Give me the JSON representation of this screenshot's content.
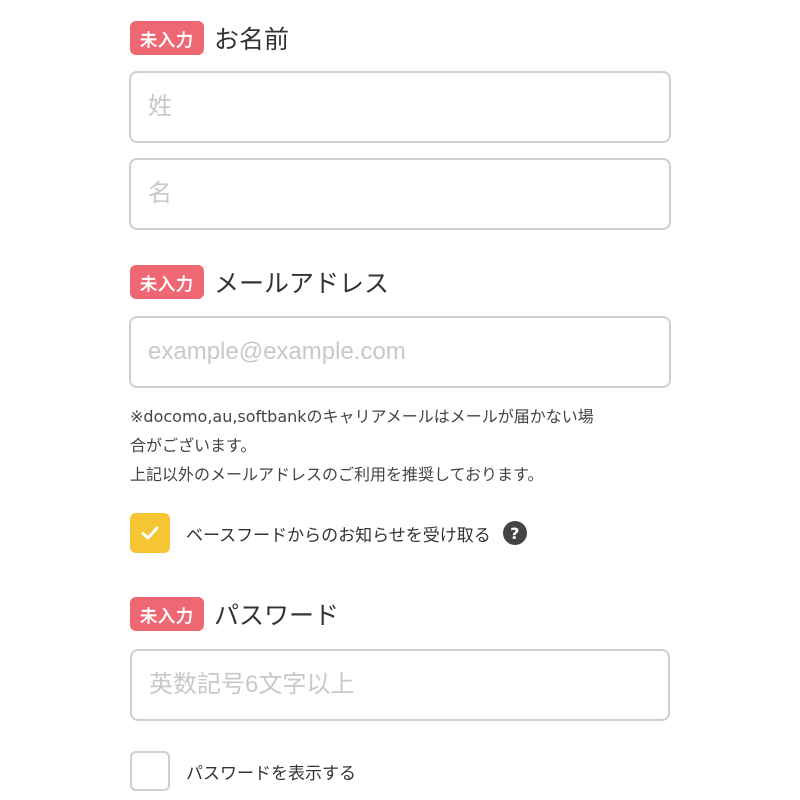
{
  "colors": {
    "badge_required": "#f06774",
    "checkbox_checked": "#f5c534",
    "help_icon": "#444444"
  },
  "name_section": {
    "badge": "未入力",
    "label": "お名前",
    "last_name_placeholder": "姓",
    "first_name_placeholder": "名"
  },
  "email_section": {
    "badge": "未入力",
    "label": "メールアドレス",
    "placeholder": "example@example.com",
    "note_lines": [
      "※docomo,au,softbankのキャリアメールはメールが届かない場",
      "合がございます。",
      "上記以外のメールアドレスのご利用を推奨しております。"
    ]
  },
  "newsletter": {
    "label": "ベースフードからのお知らせを受け取る",
    "checked": true,
    "check_icon": "check-icon",
    "help_icon": "question-circle-icon",
    "help_glyph": "?"
  },
  "password_section": {
    "badge": "未入力",
    "label": "パスワード",
    "placeholder": "英数記号6文字以上"
  },
  "show_password": {
    "label": "パスワードを表示する",
    "checked": false
  }
}
